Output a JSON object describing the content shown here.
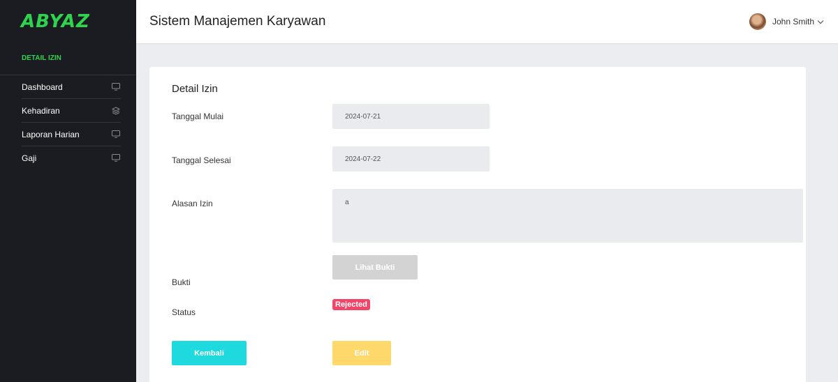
{
  "brand": {
    "logo_text": "ABYAZ",
    "accent": "#2fd44e"
  },
  "sidebar": {
    "section_title": "DETAIL IZIN",
    "items": [
      {
        "label": "Dashboard",
        "icon": "monitor-icon"
      },
      {
        "label": "Kehadiran",
        "icon": "layers-icon"
      },
      {
        "label": "Laporan Harian",
        "icon": "monitor-icon"
      },
      {
        "label": "Gaji",
        "icon": "monitor-icon"
      }
    ]
  },
  "header": {
    "title": "Sistem Manajemen Karyawan",
    "user_name": "John Smith",
    "user_menu_icon": "chevron-down-icon"
  },
  "detail": {
    "title": "Detail Izin",
    "start_date_label": "Tanggal Mulai",
    "start_date_value": "2024-07-21",
    "end_date_label": "Tanggal Selesai",
    "end_date_value": "2024-07-22",
    "reason_label": "Alasan Izin",
    "reason_value": "a",
    "proof_label": "Bukti",
    "proof_button": "Lihat Bukti",
    "status_label": "Status",
    "status_value": "Rejected",
    "back_button": "Kembali",
    "edit_button": "Edit"
  },
  "colors": {
    "sidebar_bg": "#1b1b22",
    "status_rejected": "#f1456a",
    "back_button": "#1ed9de",
    "edit_button": "#ffd86b",
    "proof_button": "#d3d3d3"
  }
}
